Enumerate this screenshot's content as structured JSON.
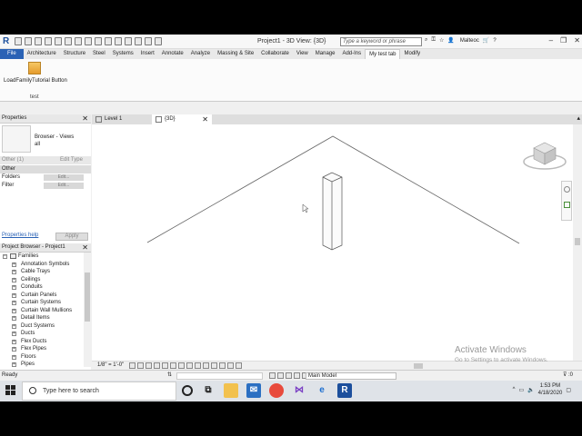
{
  "titlebar": {
    "app_letter": "R",
    "title": "Project1 - 3D View: {3D}",
    "search_placeholder": "Type a keyword or phrase",
    "user": "Malteoc"
  },
  "ribbon_tabs": [
    "File",
    "Architecture",
    "Structure",
    "Steel",
    "Systems",
    "Insert",
    "Annotate",
    "Analyze",
    "Massing & Site",
    "Collaborate",
    "View",
    "Manage",
    "Add-Ins",
    "My test tab",
    "Modify"
  ],
  "ribbon": {
    "button_label": "LoadFamilyTutorial Button",
    "panel_label": "test"
  },
  "properties": {
    "header": "Properties",
    "type_line1": "Browser - Views",
    "type_line2": "all",
    "selector": "Other (1)",
    "edit_type": "Edit Type",
    "section": "Other",
    "rows": [
      {
        "label": "Folders",
        "value": "Edit..."
      },
      {
        "label": "Filter",
        "value": "Edit..."
      }
    ],
    "help_link": "Properties help",
    "apply": "Apply"
  },
  "project_browser": {
    "header": "Project Browser - Project1",
    "root": "Families",
    "items": [
      "Annotation Symbols",
      "Cable Trays",
      "Ceilings",
      "Conduits",
      "Curtain Panels",
      "Curtain Systems",
      "Curtain Wall Mullions",
      "Detail Items",
      "Duct Systems",
      "Ducts",
      "Flex Ducts",
      "Flex Pipes",
      "Floors",
      "Pipes"
    ]
  },
  "doc_tabs": [
    {
      "label": "Level 1"
    },
    {
      "label": "{3D}"
    }
  ],
  "viewcube_label": "FRONT",
  "view_bar": {
    "scale": "1/8\" = 1'-0\""
  },
  "status": {
    "ready": "Ready",
    "model": "Main Model"
  },
  "watermark": {
    "line1": "Activate Windows",
    "line2": "Go to Settings to activate Windows."
  },
  "taskbar": {
    "search_placeholder": "Type here to search",
    "time": "1:53 PM",
    "date": "4/18/2020"
  },
  "colors": {
    "file_tab": "#2a62b5",
    "revit_blue": "#1c4f9c"
  }
}
